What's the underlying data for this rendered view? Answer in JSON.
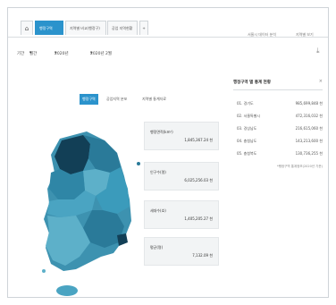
{
  "tabs": [
    {
      "label": "행정구역"
    },
    {
      "label": "지역별 비교(행정구)"
    },
    {
      "label": "공업 지역현황"
    }
  ],
  "tab_add_label": "+",
  "home_icon": "home-icon",
  "top_links": [
    "서울시 데이터 분석",
    "지역별 보기"
  ],
  "filters": {
    "year_label": "기간",
    "year_value": "월간",
    "month_value": "2020년",
    "region_value": "2020년 2월"
  },
  "subtabs": [
    "행정구역",
    "공업지역 분포",
    "지역별 통계자료"
  ],
  "cards": [
    {
      "label": "행정면적(km²)",
      "value": "1,845,367.24 천"
    },
    {
      "label": "인구수(명)",
      "value": "6,025,256.03 천"
    },
    {
      "label": "세대수(호)",
      "value": "1,405,205.27 천"
    },
    {
      "label": "평균(명)",
      "value": "7,132.09 천"
    }
  ],
  "panel": {
    "title": "행정구역 별 통계 현황",
    "close_label": "×",
    "rows": [
      {
        "name": "01. 경기도",
        "value": "985,699,848 천"
      },
      {
        "name": "02. 서울특별시",
        "value": "472,316,032 천"
      },
      {
        "name": "03. 경상남도",
        "value": "216,615,060 천"
      },
      {
        "name": "04. 충청남도",
        "value": "143,213,600 천"
      },
      {
        "name": "05. 충청북도",
        "value": "130,736,255 천"
      }
    ],
    "note": "*행정구역 통계정보(2020년 기준)"
  },
  "colors": {
    "accent": "#2b93cc",
    "map_dark": "#123f56",
    "map_mid": "#2a7a99",
    "map_light": "#5db0c9"
  }
}
